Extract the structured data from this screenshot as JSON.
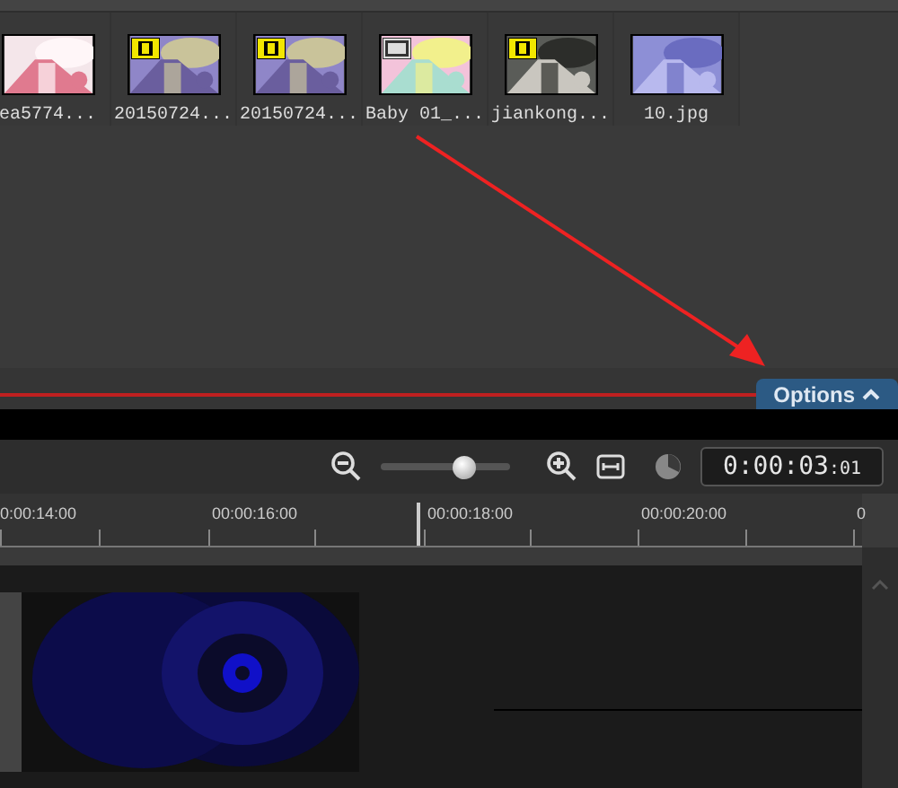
{
  "media_bin": {
    "items": [
      {
        "label": "ea5774..."
      },
      {
        "label": "20150724...",
        "kind": "video"
      },
      {
        "label": "20150724...",
        "kind": "video"
      },
      {
        "label": "Baby 01_...",
        "kind": "project"
      },
      {
        "label": "jiankong...",
        "kind": "video"
      },
      {
        "label": "10.jpg"
      }
    ]
  },
  "options_tab": {
    "label": "Options",
    "expanded": true
  },
  "toolbar": {
    "zoom": {
      "level": 0.65
    },
    "time": "0:00:03",
    "frames": ":01"
  },
  "ruler": {
    "labels": [
      "0:00:14:00",
      "00:00:16:00",
      "00:00:18:00",
      "00:00:20:00",
      "0"
    ]
  }
}
